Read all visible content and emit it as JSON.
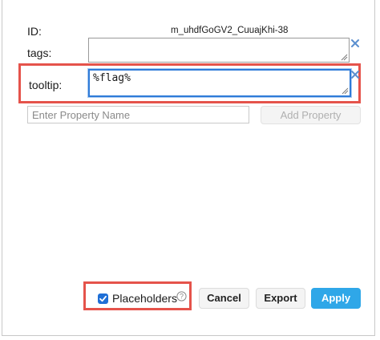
{
  "dialog": {
    "id_label": "ID:",
    "id_value": "m_uhdfGoGV2_CuuajKhi-38",
    "tags_label": "tags:",
    "tags_value": "",
    "tooltip_label": "tooltip:",
    "tooltip_value": "%flag%",
    "property_name_placeholder": "Enter Property Name",
    "add_property_label": "Add Property",
    "placeholders_label": "Placeholders",
    "placeholders_checked": true,
    "cancel_label": "Cancel",
    "export_label": "Export",
    "apply_label": "Apply"
  },
  "colors": {
    "highlight": "#e5534b",
    "accent": "#2fa7e8",
    "checkbox": "#1f6fd6",
    "remove_x": "#5b8fcf"
  },
  "icons": {
    "remove": "close-icon",
    "help": "help-circle-icon",
    "checkmark": "checkmark-icon",
    "resize": "resize-grip-icon"
  }
}
